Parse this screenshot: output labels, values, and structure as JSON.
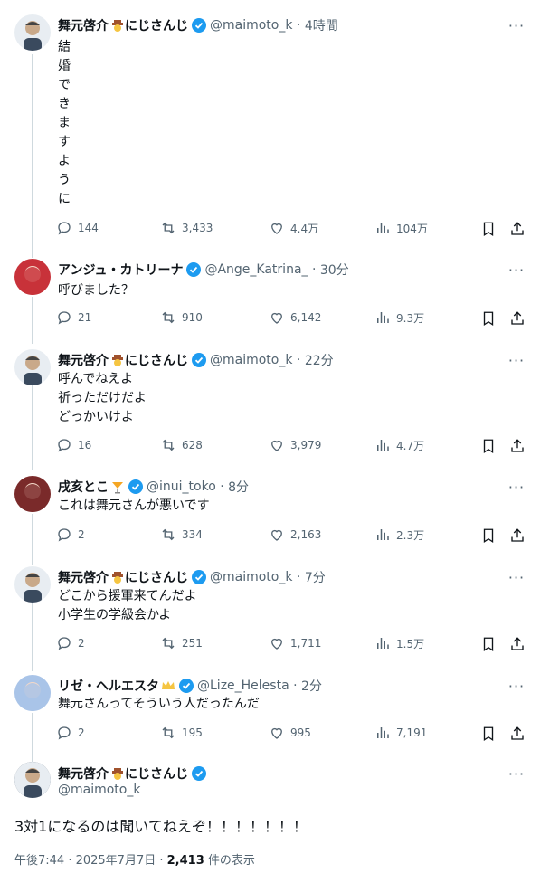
{
  "tweets": [
    {
      "name": "舞元啓介",
      "suffix": "にじさんじ",
      "handle": "@maimoto_k",
      "time": "4時間",
      "text": "結\n婚\nで\nき\nま\nす\nよ\nう\nに",
      "reply": "144",
      "retweet": "3,433",
      "like": "4.4万",
      "views": "104万",
      "avatar_color": "#3a4a5e"
    },
    {
      "name": "アンジュ・カトリーナ",
      "suffix": "",
      "handle": "@Ange_Katrina_",
      "time": "30分",
      "text": "呼びました？",
      "reply": "21",
      "retweet": "910",
      "like": "6,142",
      "views": "9.3万",
      "avatar_color": "#c8323a"
    },
    {
      "name": "舞元啓介",
      "suffix": "にじさんじ",
      "handle": "@maimoto_k",
      "time": "22分",
      "text": "呼んでねえよ\n祈っただけだよ\nどっかいけよ",
      "reply": "16",
      "retweet": "628",
      "like": "3,979",
      "views": "4.7万",
      "avatar_color": "#3a4a5e"
    },
    {
      "name": "戌亥とこ",
      "suffix": "",
      "handle": "@inui_toko",
      "time": "8分",
      "text": "これは舞元さんが悪いです",
      "reply": "2",
      "retweet": "334",
      "like": "2,163",
      "views": "2.3万",
      "avatar_color": "#7a2a2a"
    },
    {
      "name": "舞元啓介",
      "suffix": "にじさんじ",
      "handle": "@maimoto_k",
      "time": "7分",
      "text": "どこから援軍来てんだよ\n小学生の学級会かよ",
      "reply": "2",
      "retweet": "251",
      "like": "1,711",
      "views": "1.5万",
      "avatar_color": "#3a4a5e"
    },
    {
      "name": "リゼ・ヘルエスタ",
      "suffix": "",
      "handle": "@Lize_Helesta",
      "time": "2分",
      "text": "舞元さんってそういう人だったんだ",
      "reply": "2",
      "retweet": "195",
      "like": "995",
      "views": "7,191",
      "avatar_color": "#a9c4e8"
    }
  ],
  "main": {
    "name": "舞元啓介",
    "suffix": "にじさんじ",
    "handle": "@maimoto_k",
    "text": "3対1になるのは聞いてねえぞ！！！！！！！",
    "time": "午後7:44 · 2025年7月7日 · ",
    "views_count": "2,413",
    "views_label": " 件の表示"
  },
  "colors": {
    "verified": "#1d9bf0",
    "muted": "#536471",
    "line": "#cfd9de"
  }
}
